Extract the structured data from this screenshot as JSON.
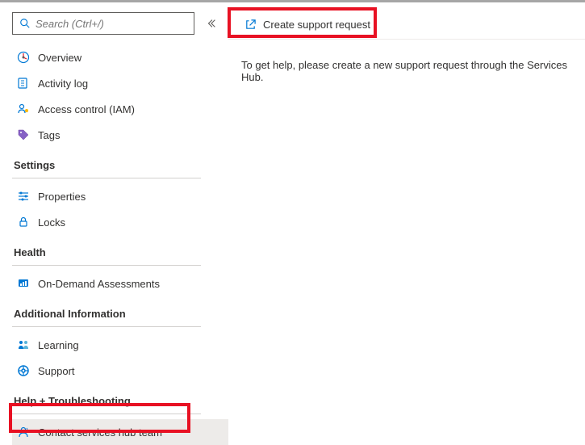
{
  "search": {
    "placeholder": "Search (Ctrl+/)"
  },
  "sidebar": {
    "items": [
      {
        "label": "Overview"
      },
      {
        "label": "Activity log"
      },
      {
        "label": "Access control (IAM)"
      },
      {
        "label": "Tags"
      }
    ],
    "sections": {
      "settings": {
        "title": "Settings",
        "items": [
          {
            "label": "Properties"
          },
          {
            "label": "Locks"
          }
        ]
      },
      "health": {
        "title": "Health",
        "items": [
          {
            "label": "On-Demand Assessments"
          }
        ]
      },
      "additional": {
        "title": "Additional Information",
        "items": [
          {
            "label": "Learning"
          },
          {
            "label": "Support"
          }
        ]
      },
      "help": {
        "title": "Help + Troubleshooting",
        "items": [
          {
            "label": "Contact services hub team"
          }
        ]
      }
    }
  },
  "toolbar": {
    "create_support_label": "Create support request"
  },
  "content": {
    "help_text": "To get help, please create a new support request through the Services Hub."
  }
}
